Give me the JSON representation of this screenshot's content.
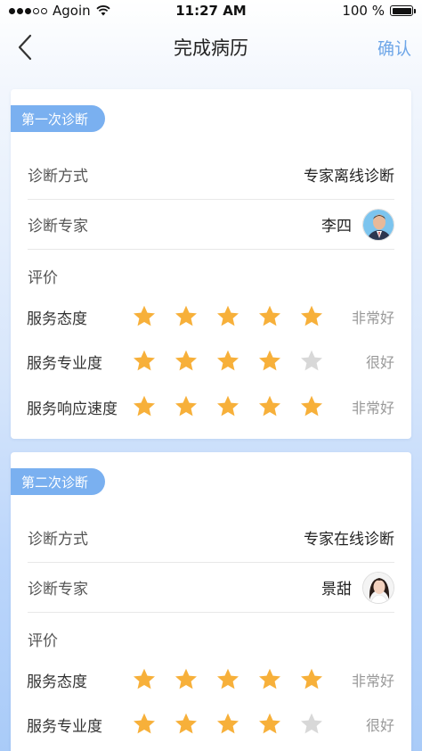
{
  "status_bar": {
    "carrier": "Agoin",
    "time": "11:27 AM",
    "battery": "100 %",
    "battery_level": 1.0
  },
  "nav": {
    "title": "完成病历",
    "confirm_label": "确认"
  },
  "diagnoses": [
    {
      "tag": "第一次诊断",
      "method_label": "诊断方式",
      "method_value": "专家离线诊断",
      "expert_label": "诊断专家",
      "expert_name": "李四",
      "evaluation_label": "评价",
      "ratings": [
        {
          "label": "服务态度",
          "stars": 5,
          "text": "非常好"
        },
        {
          "label": "服务专业度",
          "stars": 4,
          "text": "很好"
        },
        {
          "label": "服务响应速度",
          "stars": 5,
          "text": "非常好"
        }
      ]
    },
    {
      "tag": "第二次诊断",
      "method_label": "诊断方式",
      "method_value": "专家在线诊断",
      "expert_label": "诊断专家",
      "expert_name": "景甜",
      "evaluation_label": "评价",
      "ratings": [
        {
          "label": "服务态度",
          "stars": 5,
          "text": "非常好"
        },
        {
          "label": "服务专业度",
          "stars": 4,
          "text": "很好"
        }
      ]
    }
  ],
  "colors": {
    "accent": "#7ab0f0",
    "star_on": "#f7b03a",
    "star_off": "#d8d8d8",
    "confirm": "#6ea6e8"
  }
}
